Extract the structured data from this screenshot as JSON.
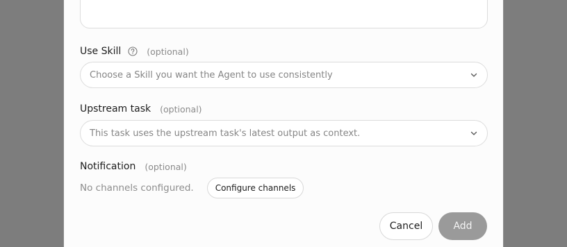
{
  "use_skill": {
    "label": "Use Skill",
    "optional": "(optional)",
    "placeholder": "Choose a Skill you want the Agent to use consistently"
  },
  "upstream_task": {
    "label": "Upstream task",
    "optional": "(optional)",
    "placeholder": "This task uses the upstream task's latest output as context."
  },
  "notification": {
    "label": "Notification",
    "optional": "(optional)",
    "status": "No channels configured.",
    "configure_label": "Configure channels"
  },
  "footer": {
    "cancel_label": "Cancel",
    "add_label": "Add"
  },
  "icons": {
    "help": "help-circle-icon",
    "chevron": "chevron-down-icon"
  }
}
